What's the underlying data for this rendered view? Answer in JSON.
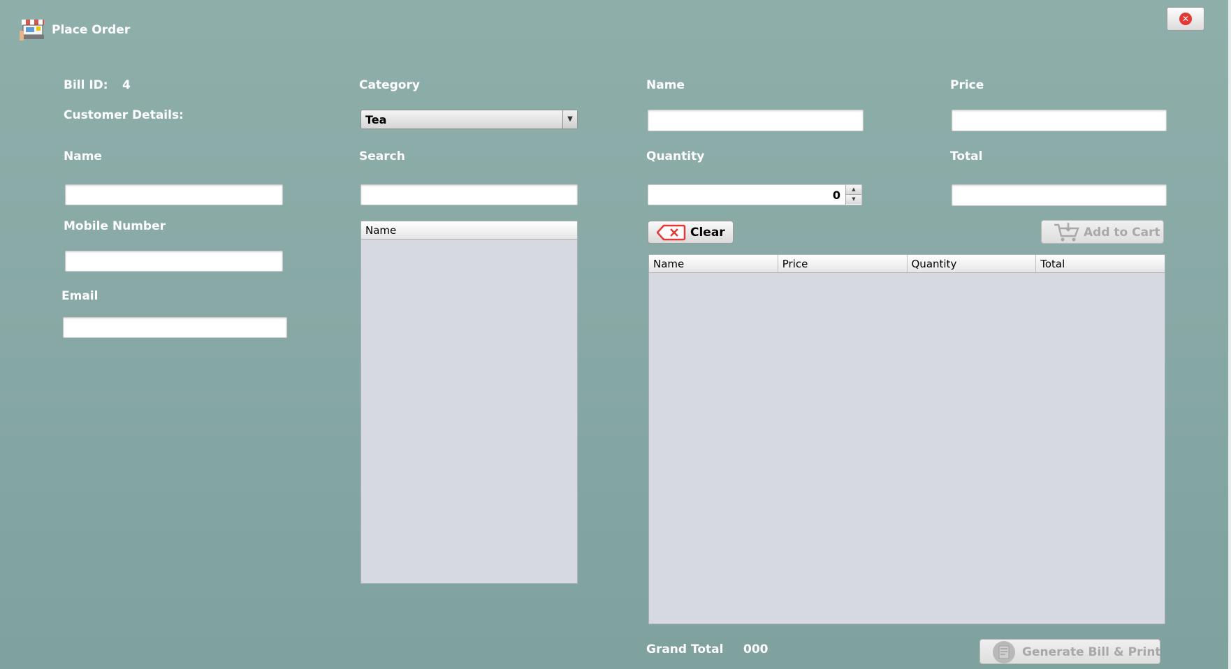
{
  "window": {
    "title": "Place Order",
    "icon": "store-icon",
    "close_icon": "close-icon"
  },
  "bill": {
    "id_label": "Bill ID:",
    "id_value": "4"
  },
  "customer": {
    "section_label": "Customer Details:",
    "name_label": "Name",
    "name_value": "",
    "mobile_label": "Mobile Number",
    "mobile_value": "",
    "email_label": "Email",
    "email_value": ""
  },
  "category": {
    "label": "Category",
    "selected": "Tea"
  },
  "search": {
    "label": "Search",
    "value": "",
    "results_columns": [
      "Name"
    ],
    "results_rows": []
  },
  "product": {
    "name_label": "Name",
    "name_value": "",
    "price_label": "Price",
    "price_value": "",
    "quantity_label": "Quantity",
    "quantity_value": "0",
    "total_label": "Total",
    "total_value": ""
  },
  "actions": {
    "clear_label": "Clear",
    "add_to_cart_label": "Add to Cart",
    "generate_label": "Generate Bill & Print"
  },
  "cart": {
    "columns": [
      "Name",
      "Price",
      "Quantity",
      "Total"
    ],
    "rows": []
  },
  "grand_total": {
    "label": "Grand Total",
    "value": "000"
  },
  "colors": {
    "background": "#8aaaa6",
    "table_bg": "#d6d9e0",
    "close_red": "#e53935"
  }
}
